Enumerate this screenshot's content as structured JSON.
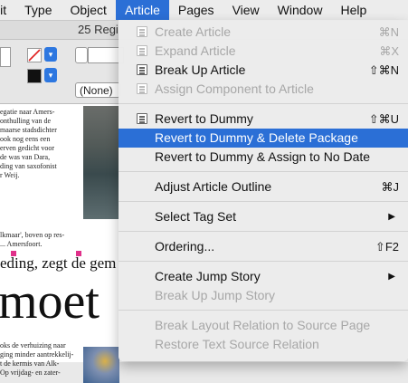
{
  "menubar": {
    "items": [
      "lit",
      "Type",
      "Object",
      "Article",
      "Pages",
      "View",
      "Window",
      "Help"
    ],
    "active": "Article"
  },
  "app": {
    "tab_title": "25 Regi",
    "stroke_field": "(None)",
    "doc": {
      "col1_text": "egatie naar Amers-\nonthulling van de\nmaarse stadsdichter\nook nog eens een\nerven gedicht voor\nde was van Dara,\nding van saxofonist\nr Weij.",
      "caption": "lkmaar', boven op res-\n... Amersfoort.",
      "headline": "eding, zegt de gem",
      "bigword": "moet",
      "col2_text": "oks de verhuizing naar\nging minder aantrekkelij-\nt de kermis van Alk-\nOp vrijdag- en zater-"
    }
  },
  "menu": {
    "items": [
      {
        "label": "Create Article",
        "shortcut": "⌘N",
        "disabled": true,
        "icon": true
      },
      {
        "label": "Expand Article",
        "shortcut": "⌘X",
        "disabled": true,
        "icon": true
      },
      {
        "label": "Break Up Article",
        "shortcut": "⇧⌘N",
        "disabled": false,
        "icon": true
      },
      {
        "label": "Assign Component to Article",
        "shortcut": "",
        "disabled": true,
        "icon": true
      },
      {
        "label": "Revert to Dummy",
        "shortcut": "⇧⌘U",
        "disabled": false,
        "icon": true
      },
      {
        "label": "Revert to Dummy & Delete Package",
        "shortcut": "",
        "disabled": false,
        "selected": true
      },
      {
        "label": "Revert to Dummy & Assign to No Date",
        "shortcut": "",
        "disabled": false
      },
      {
        "label": "Adjust Article Outline",
        "shortcut": "⌘J",
        "disabled": false
      },
      {
        "label": "Select Tag Set",
        "shortcut": "",
        "submenu": true
      },
      {
        "label": "Ordering...",
        "shortcut": "⇧F2",
        "disabled": false
      },
      {
        "label": "Create Jump Story",
        "shortcut": "",
        "submenu": true
      },
      {
        "label": "Break Up Jump Story",
        "shortcut": "",
        "disabled": true
      },
      {
        "label": "Break Layout Relation to Source Page",
        "shortcut": "",
        "disabled": true
      },
      {
        "label": "Restore Text Source Relation",
        "shortcut": "",
        "disabled": true
      }
    ]
  },
  "colors": {
    "accent": "#2b6fd6",
    "disabled_text": "#a7a7a7",
    "pink_marker": "#e0308a"
  }
}
